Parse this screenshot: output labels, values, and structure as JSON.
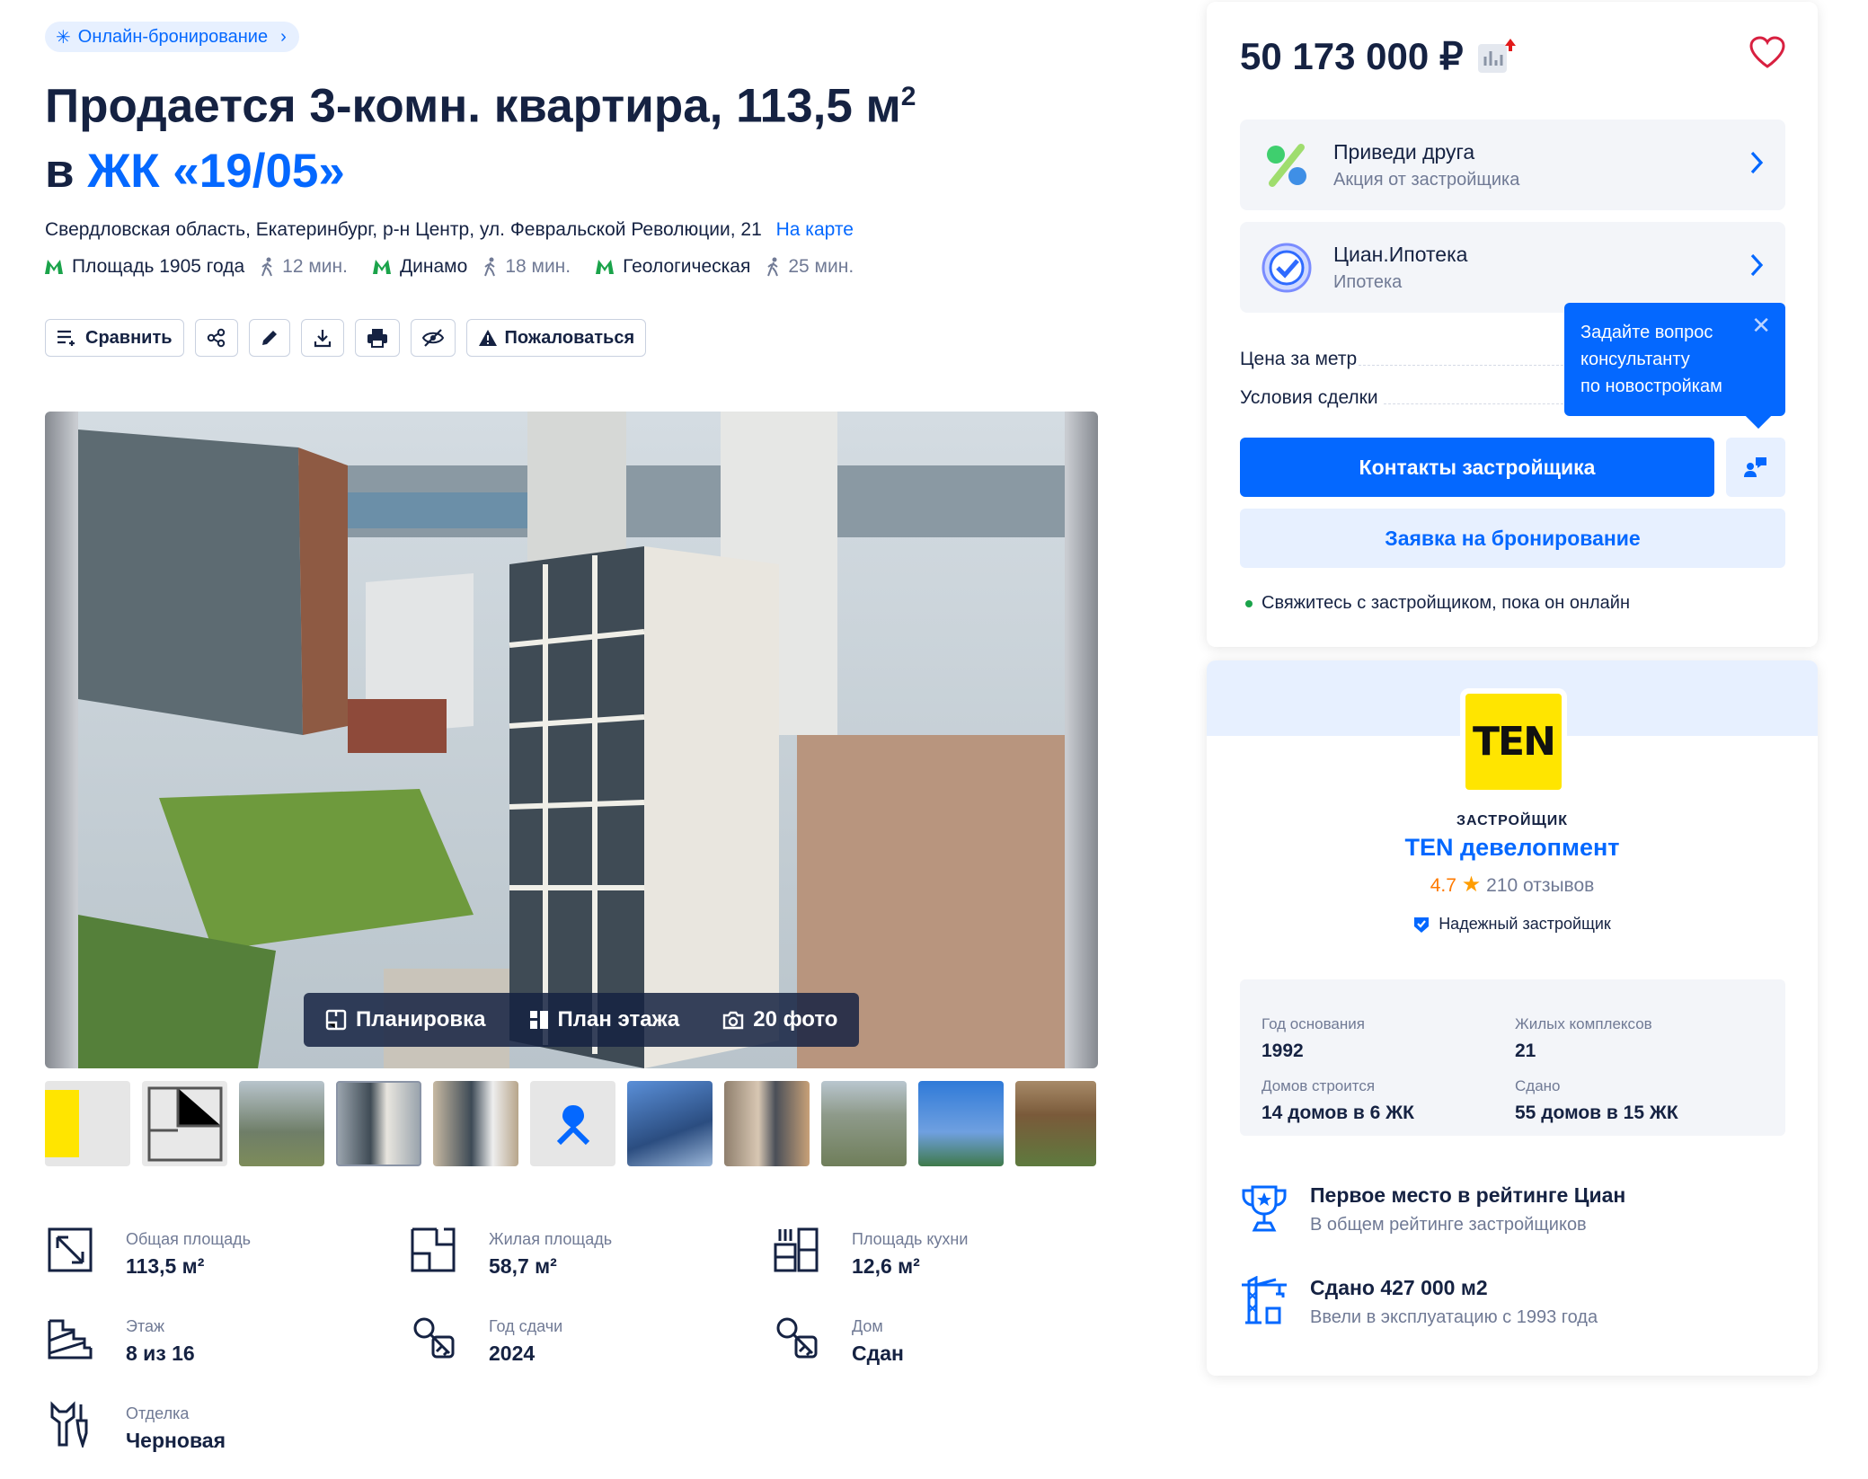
{
  "header": {
    "badge": "Онлайн-бронирование",
    "title_line1": "Продается 3-комн. квартира, 113,5 м",
    "title_sup": "2",
    "title_prefix2": "в",
    "title_link": "ЖК «19/05»"
  },
  "address": {
    "text": "Свердловская область, Екатеринбург, р-н Центр, ул. Февральской Революции, 21",
    "map_link": "На карте"
  },
  "metro": [
    {
      "name": "Площадь 1905 года",
      "time": "12 мин."
    },
    {
      "name": "Динамо",
      "time": "18 мин."
    },
    {
      "name": "Геологическая",
      "time": "25 мин."
    }
  ],
  "toolbar": {
    "compare": "Сравнить",
    "report": "Пожаловаться"
  },
  "gallery": {
    "layout": "Планировка",
    "floor_plan": "План этажа",
    "photos": "20 фото"
  },
  "features": [
    {
      "icon": "area-icon",
      "label": "Общая площадь",
      "value": "113,5 м²"
    },
    {
      "icon": "living-area-icon",
      "label": "Жилая площадь",
      "value": "58,7 м²"
    },
    {
      "icon": "kitchen-icon",
      "label": "Площадь кухни",
      "value": "12,6 м²"
    },
    {
      "icon": "stairs-icon",
      "label": "Этаж",
      "value": "8 из 16"
    },
    {
      "icon": "keys-icon",
      "label": "Год сдачи",
      "value": "2024"
    },
    {
      "icon": "keys-icon",
      "label": "Дом",
      "value": "Сдан"
    },
    {
      "icon": "tools-icon",
      "label": "Отделка",
      "value": "Черновая"
    }
  ],
  "price": {
    "value": "50 173 000 ₽"
  },
  "promos": [
    {
      "title": "Приведи друга",
      "subtitle": "Акция от застройщика"
    },
    {
      "title": "Циан.Ипотека",
      "subtitle": "Ипотека"
    }
  ],
  "details": {
    "price_per_meter": "Цена за метр",
    "deal_terms": "Условия сделки"
  },
  "tooltip": {
    "text1": "Задайте вопрос",
    "text2": "консультанту",
    "text3": "по новостройкам",
    "close": "✕"
  },
  "buttons": {
    "contacts": "Контакты застройщика",
    "booking": "Заявка на бронирование"
  },
  "online_note": "Свяжитесь с застройщиком, пока он онлайн",
  "developer": {
    "logo_text": "TEN",
    "label": "ЗАСТРОЙЩИК",
    "name": "TEN девелопмент",
    "rating": "4.7",
    "reviews": "210 отзывов",
    "reliable": "Надежный застройщик",
    "stats": [
      {
        "label": "Год основания",
        "value": "1992"
      },
      {
        "label": "Жилых комплексов",
        "value": "21"
      },
      {
        "label": "Домов строится",
        "value": "14 домов в 6 ЖК"
      },
      {
        "label": "Сдано",
        "value": "55 домов в 15 ЖК"
      }
    ],
    "achievements": [
      {
        "title": "Первое место в рейтинге Циан",
        "subtitle": "В общем рейтинге застройщиков"
      },
      {
        "title": "Сдано 427 000 м2",
        "subtitle": "Ввели в эксплуатацию с 1993 года"
      }
    ]
  },
  "colors": {
    "accent": "#0468ff",
    "text": "#152242",
    "muted": "#707a95",
    "metro_green": "#1aa34a",
    "logo_yellow": "#ffe500"
  }
}
